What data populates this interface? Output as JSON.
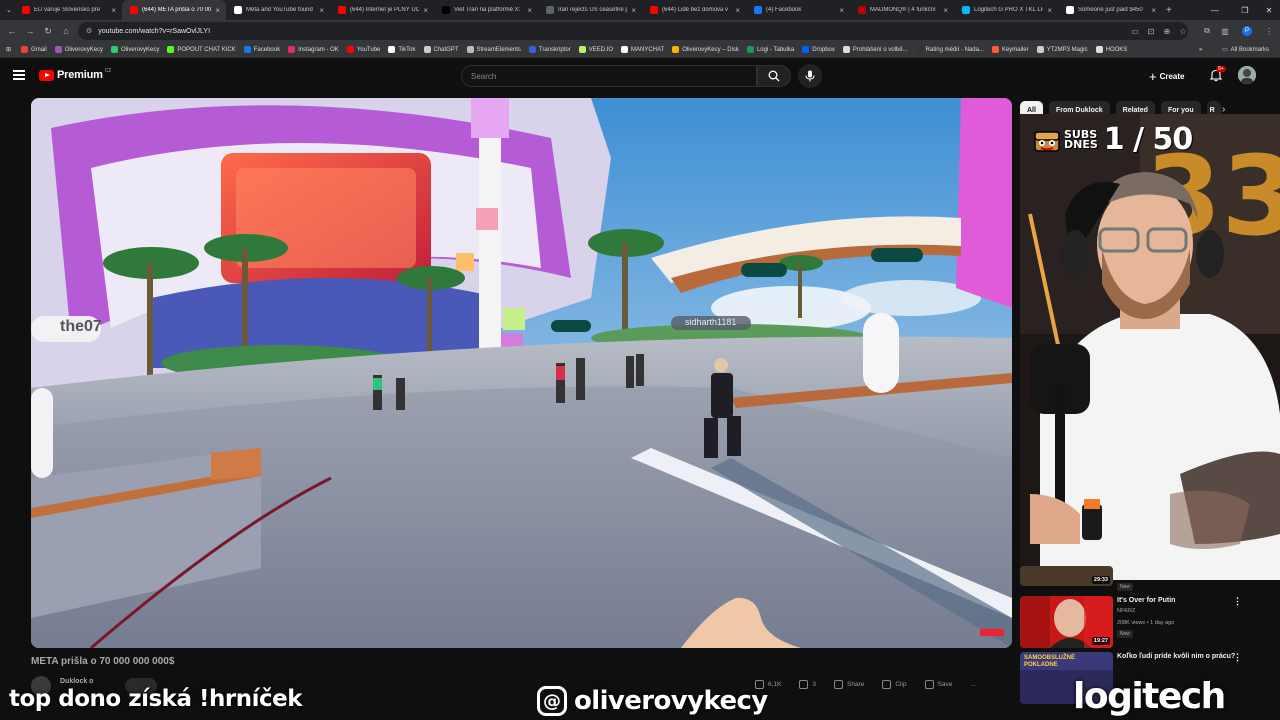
{
  "browser": {
    "tabs": [
      {
        "title": "EU varuje Slovensko pře",
        "color": "#ff0000",
        "active": false
      },
      {
        "title": "(644) META prišla o 70 00",
        "color": "#ff0000",
        "active": true
      },
      {
        "title": "Meta and YouTube found",
        "color": "#ffffff",
        "active": false
      },
      {
        "title": "(644) Internet je PLNÝ ÚČ",
        "color": "#ff0000",
        "active": false
      },
      {
        "title": "Viet Tran na platformě X:",
        "color": "#000000",
        "active": false
      },
      {
        "title": "Iran rejects US ceasefire p",
        "color": "#5f6368",
        "active": false
      },
      {
        "title": "(644) Lidé bez domova v",
        "color": "#ff0000",
        "active": false
      },
      {
        "title": "(4) Facebook",
        "color": "#1877f2",
        "active": false
      },
      {
        "title": "MADMONQ® | 4 funkční",
        "color": "#c00000",
        "active": false
      },
      {
        "title": "Logitech G PRO X TKL LIG",
        "color": "#00b8fc",
        "active": false
      },
      {
        "title": "Someone just paid $450",
        "color": "#ffffff",
        "active": false
      }
    ],
    "url": "youtube.com/watch?v=rSawOvlJLYI",
    "bookmarks": [
      {
        "label": "Gmail",
        "color": "#ea4335"
      },
      {
        "label": "OliverovyKecy",
        "color": "#9b59b6"
      },
      {
        "label": "OliverovyKecy",
        "color": "#2ecc71"
      },
      {
        "label": "POPOUT CHAT KICK",
        "color": "#53fc18"
      },
      {
        "label": "Facebook",
        "color": "#1877f2"
      },
      {
        "label": "Instagram - OK",
        "color": "#e1306c"
      },
      {
        "label": "YouTube",
        "color": "#ff0000"
      },
      {
        "label": "TikTok",
        "color": "#ffffff"
      },
      {
        "label": "ChatGPT",
        "color": "#cccccc"
      },
      {
        "label": "StreamElements",
        "color": "#bbbbbb"
      },
      {
        "label": "Transkriptor",
        "color": "#3b5bdb"
      },
      {
        "label": "VEED.IO",
        "color": "#b6f36a"
      },
      {
        "label": "MANYCHAT",
        "color": "#ffffff"
      },
      {
        "label": "OliverovyKecy – Disk",
        "color": "#f4b400"
      },
      {
        "label": "Logi - Tabulka",
        "color": "#0f9d58"
      },
      {
        "label": "Dropbox",
        "color": "#0061ff"
      },
      {
        "label": "Prohlášení o volbě...",
        "color": "#dddddd"
      },
      {
        "label": "Rating médií - Nada...",
        "color": "#333333"
      },
      {
        "label": "Keymailer",
        "color": "#ff5a36"
      },
      {
        "label": "YT2MP3 Magic",
        "color": "#cccccc"
      },
      {
        "label": "HOOKS",
        "color": "#dddddd"
      }
    ],
    "all_bookmarks": "All Bookmarks",
    "more": "»"
  },
  "youtube": {
    "logo_word": "Premium",
    "country": "CZ",
    "search_placeholder": "Search",
    "create_label": "Create",
    "notif_badge": "9+",
    "video_title": "META prišla o 70 000 000 000$",
    "channel_name": "Duklock o",
    "actions": [
      {
        "label": "6,1K"
      },
      {
        "label": "3"
      },
      {
        "label": "Share"
      },
      {
        "label": "Clip"
      },
      {
        "label": "Save"
      },
      {
        "label": "..."
      }
    ],
    "chips": [
      "All",
      "From Duklock",
      "Related",
      "For you",
      "R"
    ],
    "sidebar_videos": [
      {
        "title": "",
        "channel": "",
        "meta": "",
        "badge": "New",
        "duration": "29:33"
      },
      {
        "title": "It's Over for Putin",
        "channel": "NFKRZ",
        "meta": "208K views • 1 day ago",
        "badge": "New",
        "duration": "19:27"
      },
      {
        "title": "Koľko ľudí príde kvôli nim o prácu?",
        "channel": "",
        "meta": "",
        "badge": "",
        "duration": "",
        "thumb_text": "SAMOOBSLUŽNÉ POKLADNE"
      }
    ]
  },
  "overlay": {
    "subs_label_1": "SUBS",
    "subs_label_2": "DNES",
    "subs_count": "1 / 50",
    "left_text": "top dono získá !hrníček",
    "center_handle": "oliverovykecy",
    "center_icon": "threads-icon",
    "brand": "logitech",
    "video_partial_name_1": "the07",
    "video_partial_name_2": "sidharth1181"
  },
  "colors": {
    "accent": "#ff0000",
    "background": "#0f0f0f"
  }
}
